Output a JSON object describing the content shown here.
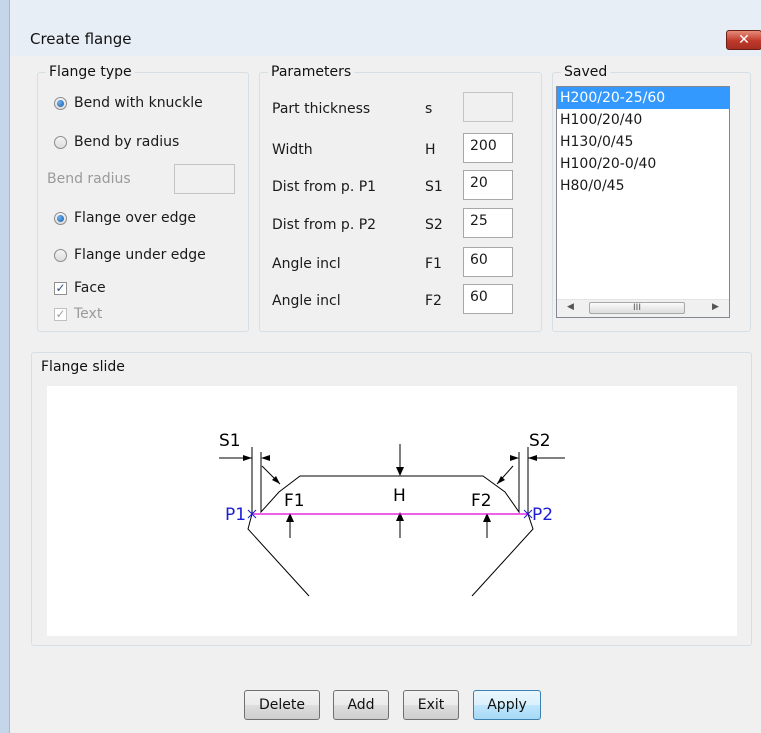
{
  "window": {
    "title": "Create flange",
    "close_glyph": "✕"
  },
  "flange_type": {
    "legend": "Flange type",
    "bend_with_knuckle": "Bend with knuckle",
    "bend_by_radius": "Bend by radius",
    "bend_radius_label": "Bend radius",
    "bend_radius_value": "",
    "flange_over_edge": "Flange over edge",
    "flange_under_edge": "Flange under edge",
    "face": "Face",
    "text": "Text",
    "selected_bend": "Bend with knuckle",
    "selected_edge": "Flange over edge",
    "face_checked": true,
    "text_checked": true
  },
  "parameters": {
    "legend": "Parameters",
    "rows": [
      {
        "label": "Part thickness",
        "symbol": "s",
        "value": ""
      },
      {
        "label": "Width",
        "symbol": "H",
        "value": "200"
      },
      {
        "label": "Dist from p. P1",
        "symbol": "S1",
        "value": "20"
      },
      {
        "label": "Dist from p. P2",
        "symbol": "S2",
        "value": "25"
      },
      {
        "label": "Angle incl",
        "symbol": "F1",
        "value": "60"
      },
      {
        "label": "Angle incl",
        "symbol": "F2",
        "value": "60"
      }
    ]
  },
  "saved": {
    "legend": "Saved",
    "items": [
      "H200/20-25/60",
      "H100/20/40",
      "H130/0/45",
      "H100/20-0/40",
      "H80/0/45"
    ],
    "selected": "H200/20-25/60",
    "scroll_left": "◀",
    "scroll_right": "▶",
    "thumb_grip": "III"
  },
  "flange_slide": {
    "legend": "Flange slide",
    "labels": {
      "s1": "S1",
      "s2": "S2",
      "f1": "F1",
      "f2": "F2",
      "h": "H",
      "p1": "P1",
      "p2": "P2"
    }
  },
  "buttons": {
    "delete": "Delete",
    "add": "Add",
    "exit": "Exit",
    "apply": "Apply"
  },
  "colors": {
    "selection": "#3399ff",
    "point_label": "#1c1cd6",
    "baseline": "#e000e0",
    "frame": "#c5d6ea"
  }
}
